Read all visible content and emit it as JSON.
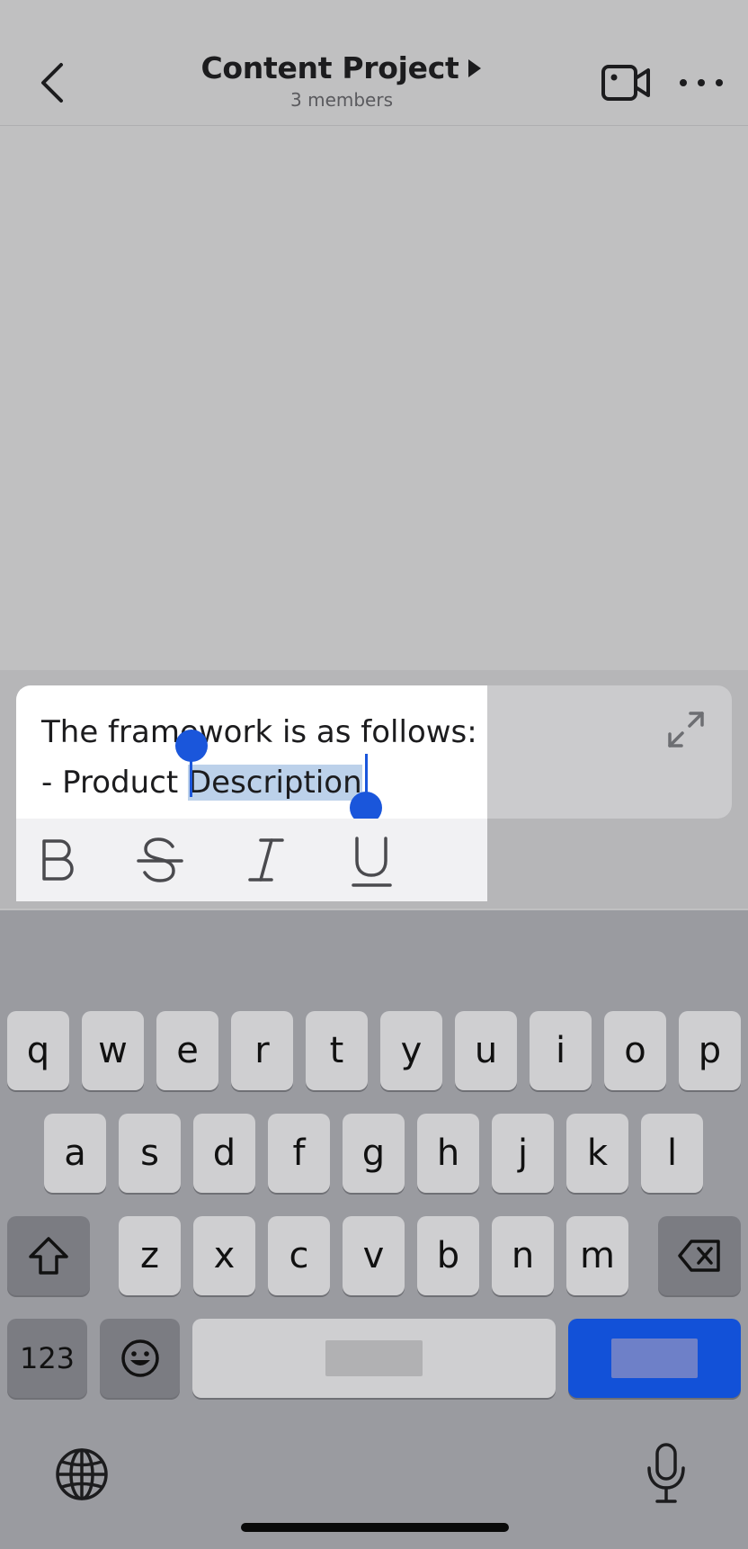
{
  "header": {
    "title": "Content Project",
    "subtitle": "3 members"
  },
  "composer": {
    "line1": "The framework is as follows:",
    "line2_prefix": "- Product ",
    "line2_selected": "Description",
    "format": [
      "B",
      "S",
      "I",
      "U"
    ]
  },
  "keyboard": {
    "row1": [
      "q",
      "w",
      "e",
      "r",
      "t",
      "y",
      "u",
      "i",
      "o",
      "p"
    ],
    "row2": [
      "a",
      "s",
      "d",
      "f",
      "g",
      "h",
      "j",
      "k",
      "l"
    ],
    "row3": [
      "z",
      "x",
      "c",
      "v",
      "b",
      "n",
      "m"
    ],
    "numbers_label": "123"
  },
  "colors": {
    "accent": "#1a56db",
    "selection": "#bcd1ea",
    "return_key": "#1251d8"
  }
}
